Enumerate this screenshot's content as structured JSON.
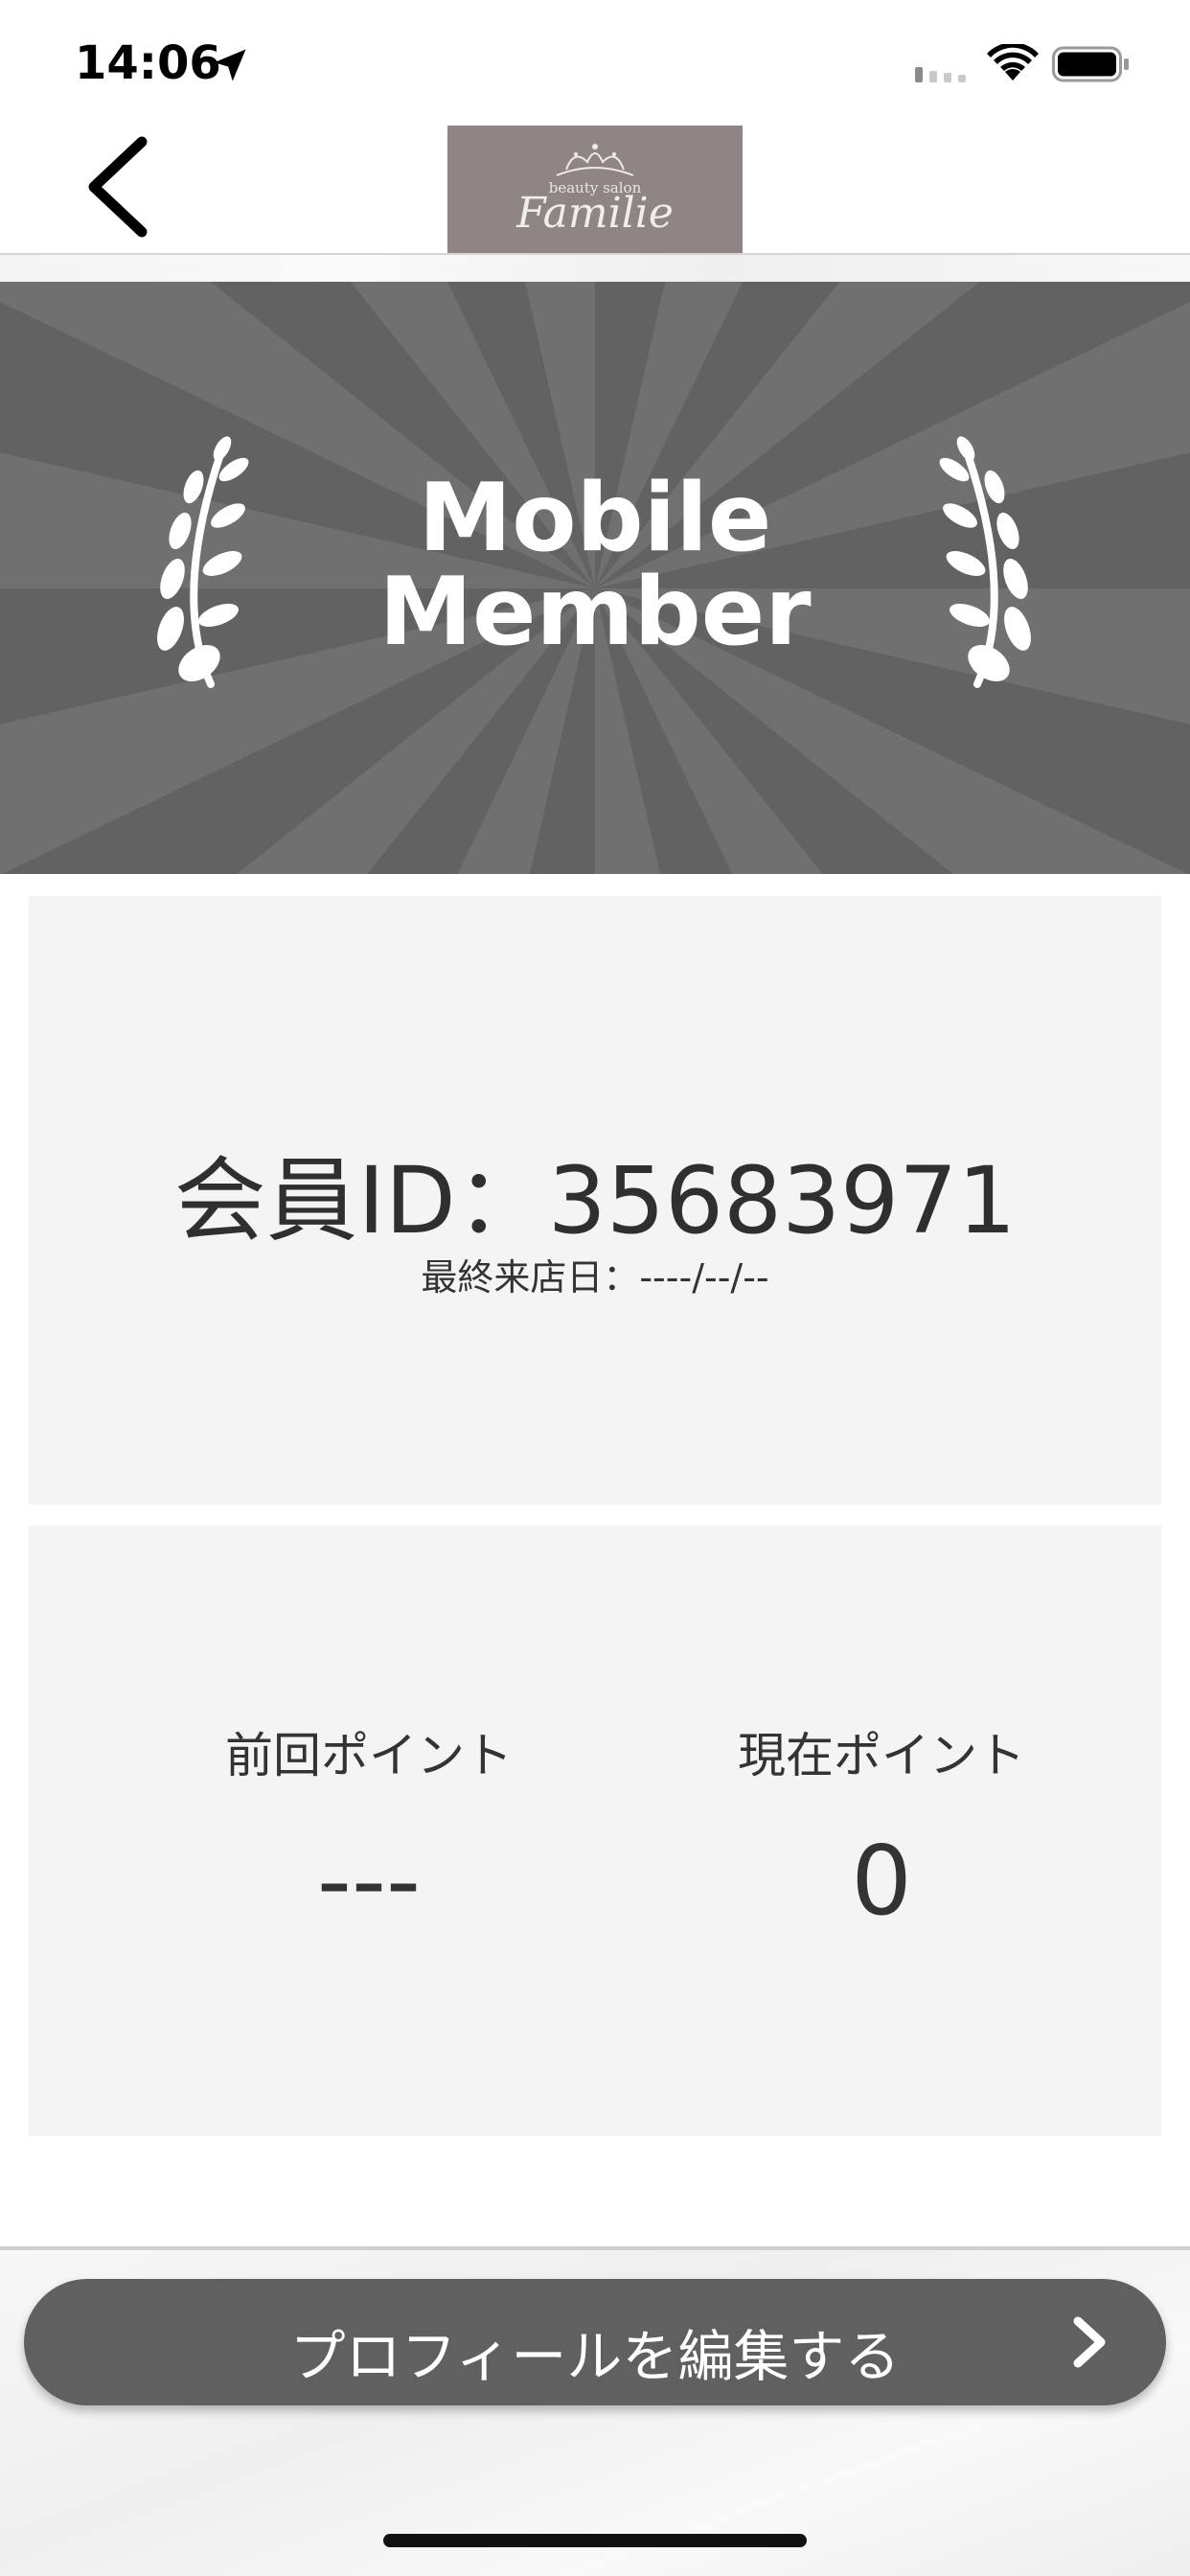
{
  "status_bar": {
    "time": "14:06",
    "icons": [
      "location-arrow-icon",
      "signal-icon",
      "wifi-icon",
      "battery-icon"
    ]
  },
  "nav": {
    "back_icon": "chevron-left-icon",
    "logo": {
      "small_text": "beauty salon",
      "name": "Familie",
      "background": "#8e8584"
    }
  },
  "banner": {
    "title_line1": "Mobile",
    "title_line2": "Member",
    "background": "#626262",
    "ray_color": "#707070",
    "decorations": [
      "laurel-left-icon",
      "laurel-right-icon"
    ]
  },
  "member_card": {
    "member_id": "会員ID：35683971",
    "last_visit": "最終来店日：----/--/--"
  },
  "points_card": {
    "previous": {
      "label": "前回ポイント",
      "value": "---"
    },
    "current": {
      "label": "現在ポイント",
      "value": "0"
    }
  },
  "actions": {
    "edit_profile_label": "プロフィールを編集する",
    "edit_profile_icon": "chevron-right-icon",
    "button_color": "#606060"
  }
}
